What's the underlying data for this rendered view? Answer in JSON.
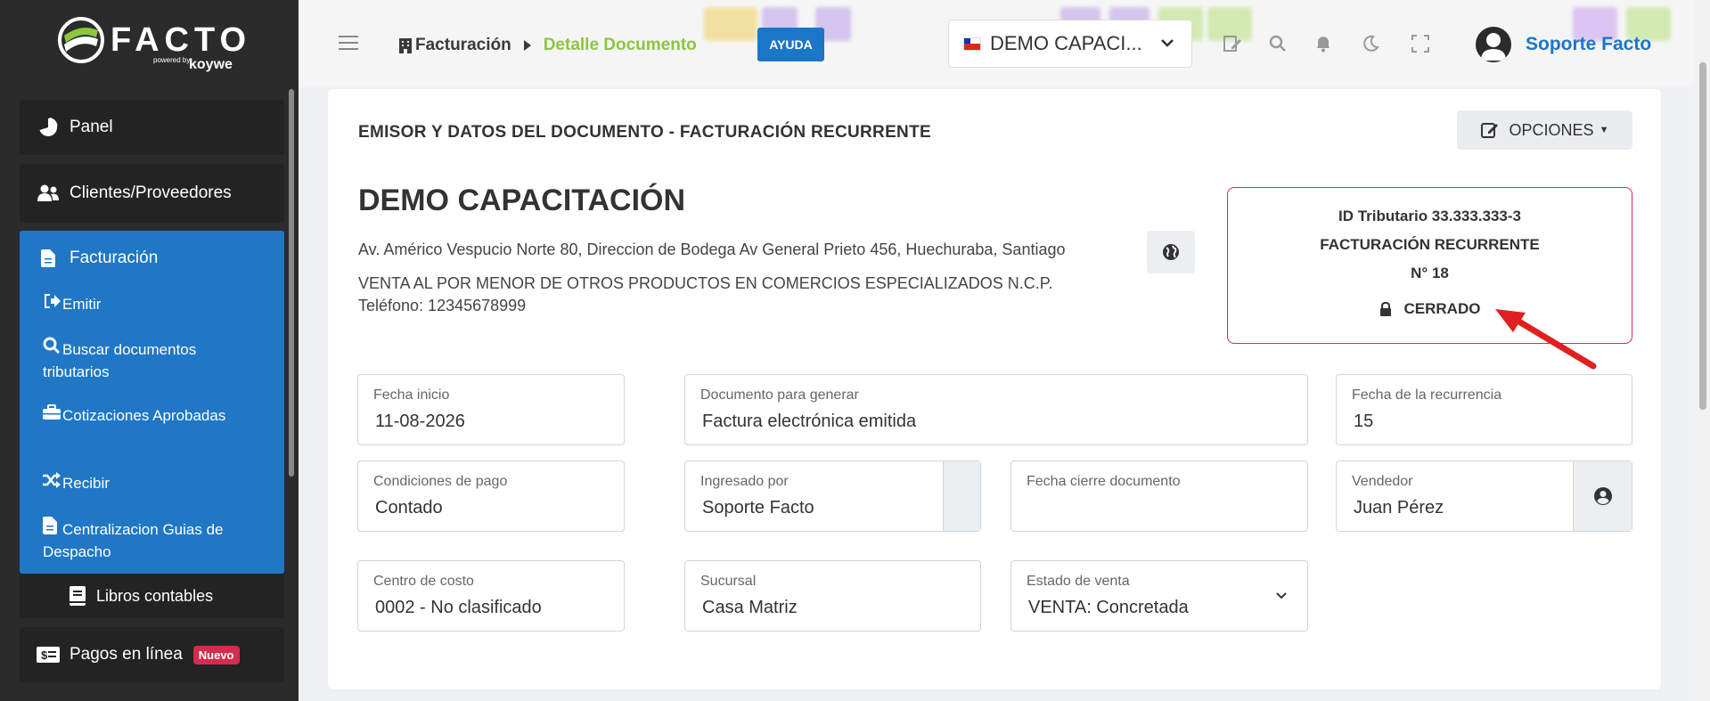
{
  "brand": {
    "name": "FACTO",
    "powered_by": "powered by",
    "partner": "koywe"
  },
  "sidebar": {
    "items": [
      {
        "label": "Panel",
        "icon": "pie-chart-icon"
      },
      {
        "label": "Clientes/Proveedores",
        "icon": "users-icon"
      }
    ],
    "open_section": {
      "label": "Facturación",
      "icon": "file-icon",
      "subitems": [
        {
          "label": "Emitir",
          "icon": "sign-out-icon"
        },
        {
          "label": "Buscar documentos tributarios",
          "icon": "search-icon"
        },
        {
          "label": "Cotizaciones Aprobadas",
          "icon": "briefcase-icon"
        },
        {
          "label": "Recibir",
          "icon": "shuffle-icon"
        },
        {
          "label": "Centralizacion Guias de Despacho",
          "icon": "document-icon"
        }
      ]
    },
    "libros": {
      "label": "Libros contables",
      "icon": "book-icon"
    },
    "pagos": {
      "label": "Pagos en línea",
      "badge": "Nuevo",
      "icon": "money-icon"
    }
  },
  "header": {
    "breadcrumb_home": "Facturación",
    "breadcrumb_current": "Detalle Documento",
    "help_label": "AYUDA",
    "company_selected": "DEMO CAPACI...",
    "user_name": "Soporte Facto"
  },
  "card": {
    "title": "EMISOR Y DATOS DEL DOCUMENTO - FACTURACIÓN RECURRENTE",
    "options_label": "OPCIONES",
    "company_name": "DEMO CAPACITACIÓN",
    "address": "Av. Américo Vespucio Norte 80, Direccion de Bodega Av General Prieto 456, Huechuraba, Santiago",
    "activity": "VENTA AL POR MENOR DE OTROS PRODUCTOS EN COMERCIOS ESPECIALIZADOS N.C.P.",
    "phone": "Teléfono: 12345678999",
    "status": {
      "tax_id": "ID Tributario 33.333.333-3",
      "doc_type": "FACTURACIÓN RECURRENTE",
      "number": "N° 18",
      "state": "CERRADO"
    }
  },
  "fields": {
    "fecha_inicio": {
      "label": "Fecha inicio",
      "value": "11-08-2026"
    },
    "documento": {
      "label": "Documento para generar",
      "value": "Factura electrónica emitida"
    },
    "recurrencia": {
      "label": "Fecha de la recurrencia",
      "value": "15"
    },
    "condiciones": {
      "label": "Condiciones de pago",
      "value": "Contado"
    },
    "ingresado": {
      "label": "Ingresado por",
      "value": "Soporte Facto"
    },
    "cierre": {
      "label": "Fecha cierre documento",
      "value": ""
    },
    "vendedor": {
      "label": "Vendedor",
      "value": "Juan Pérez"
    },
    "centro": {
      "label": "Centro de costo",
      "value": "0002 - No clasificado"
    },
    "sucursal": {
      "label": "Sucursal",
      "value": "Casa Matriz"
    },
    "estado": {
      "label": "Estado de venta",
      "value": "VENTA: Concretada"
    }
  },
  "colors": {
    "primary": "#1b76c8",
    "accent_green": "#8cc63f",
    "danger": "#d42c4c",
    "sidebar_bg": "#2b2b2b"
  }
}
